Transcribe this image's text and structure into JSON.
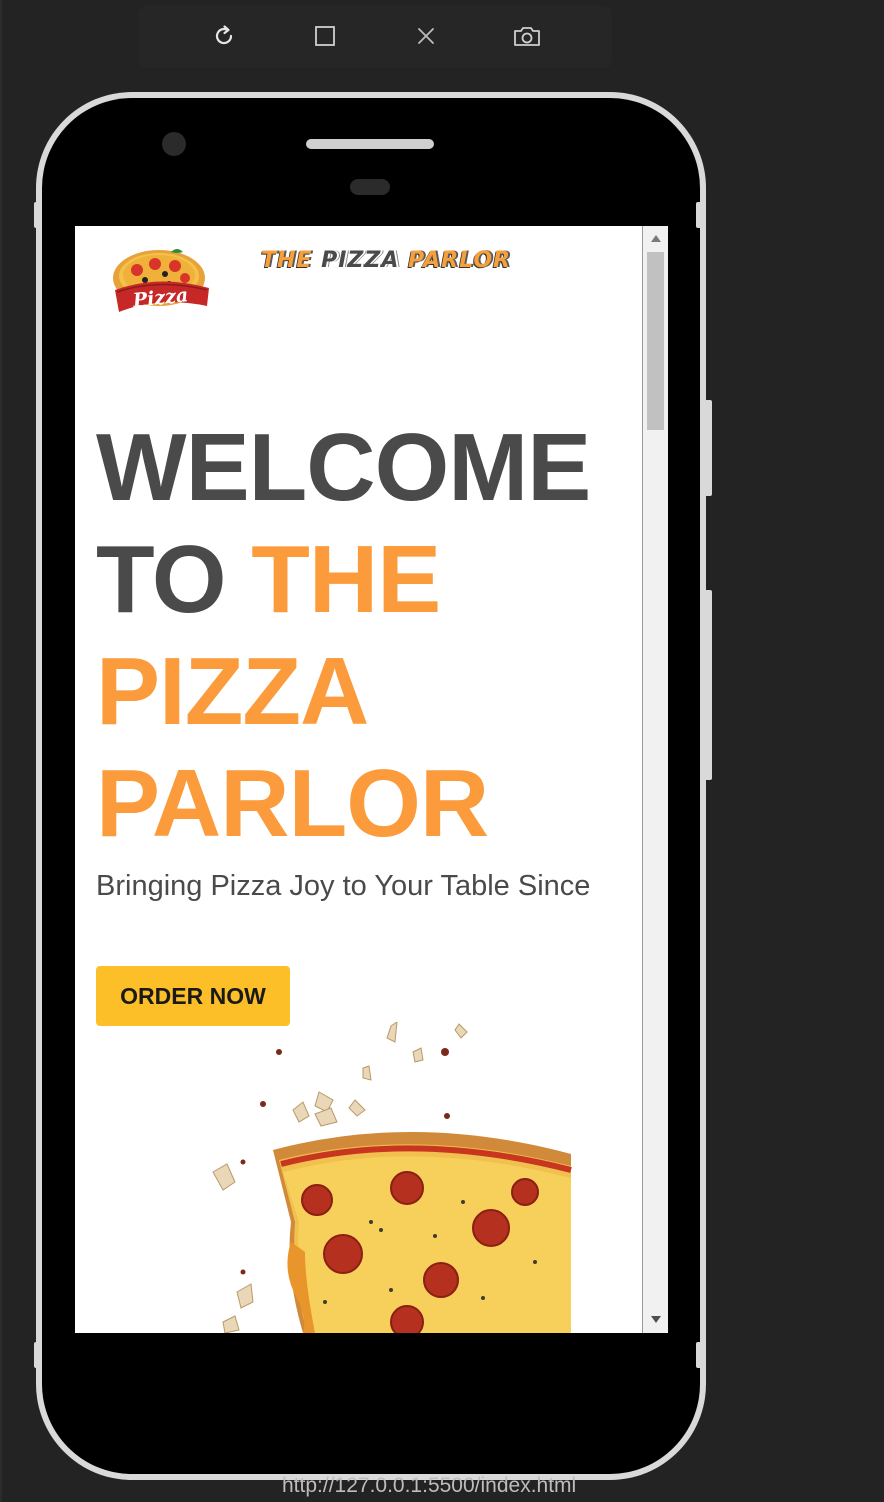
{
  "toolbar": {
    "icons": [
      "refresh-icon",
      "maximize-icon",
      "close-icon",
      "camera-icon"
    ]
  },
  "site": {
    "brand_part1": "THE ",
    "brand_part2": "PIZZA ",
    "brand_part3": "PARLOR",
    "logo_text": "Pizza",
    "hero_line1": "WELCOME",
    "hero_line2_dark": "TO ",
    "hero_line2_accent": "THE",
    "hero_line3": "PIZZA",
    "hero_line4": "PARLOR",
    "tagline": "Bringing Pizza Joy to Your Table Since",
    "order_button": "ORDER NOW"
  },
  "status": {
    "url": "http://127.0.0.1:5500/index.html"
  },
  "colors": {
    "accent": "#fb9b3c",
    "button": "#fdbf28",
    "text_dark": "#4a4a4a"
  }
}
